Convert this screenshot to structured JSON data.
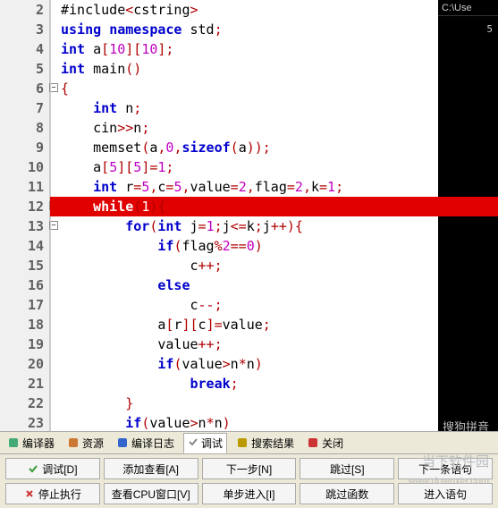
{
  "right_panel": {
    "title": "C:\\Use",
    "num": "5"
  },
  "lines": [
    {
      "n": 2,
      "fold": null,
      "hl": false,
      "indent": 0,
      "tokens": [
        [
          "id",
          "#include"
        ],
        [
          "op",
          "<"
        ],
        [
          "id",
          "cstring"
        ],
        [
          "op",
          ">"
        ]
      ]
    },
    {
      "n": 3,
      "fold": null,
      "hl": false,
      "indent": 0,
      "tokens": [
        [
          "kw",
          "using"
        ],
        [
          "id",
          " "
        ],
        [
          "kw",
          "namespace"
        ],
        [
          "id",
          " std"
        ],
        [
          "op",
          ";"
        ]
      ]
    },
    {
      "n": 4,
      "fold": null,
      "hl": false,
      "indent": 0,
      "tokens": [
        [
          "kw",
          "int"
        ],
        [
          "id",
          " a"
        ],
        [
          "op",
          "["
        ],
        [
          "num",
          "10"
        ],
        [
          "op",
          "]["
        ],
        [
          "num",
          "10"
        ],
        [
          "op",
          "];"
        ]
      ]
    },
    {
      "n": 5,
      "fold": null,
      "hl": false,
      "indent": 0,
      "tokens": [
        [
          "kw",
          "int"
        ],
        [
          "id",
          " main"
        ],
        [
          "br",
          "()"
        ]
      ]
    },
    {
      "n": 6,
      "fold": "-",
      "hl": false,
      "indent": 0,
      "tokens": [
        [
          "br",
          "{"
        ]
      ]
    },
    {
      "n": 7,
      "fold": null,
      "hl": false,
      "indent": 1,
      "tokens": [
        [
          "kw",
          "int"
        ],
        [
          "id",
          " n"
        ],
        [
          "op",
          ";"
        ]
      ]
    },
    {
      "n": 8,
      "fold": null,
      "hl": false,
      "indent": 1,
      "tokens": [
        [
          "id",
          "cin"
        ],
        [
          "op",
          ">>"
        ],
        [
          "id",
          "n"
        ],
        [
          "op",
          ";"
        ]
      ]
    },
    {
      "n": 9,
      "fold": null,
      "hl": false,
      "indent": 1,
      "tokens": [
        [
          "id",
          "memset"
        ],
        [
          "br",
          "("
        ],
        [
          "id",
          "a"
        ],
        [
          "op",
          ","
        ],
        [
          "num",
          "0"
        ],
        [
          "op",
          ","
        ],
        [
          "kw",
          "sizeof"
        ],
        [
          "br",
          "("
        ],
        [
          "id",
          "a"
        ],
        [
          "br",
          "))"
        ],
        [
          "op",
          ";"
        ]
      ]
    },
    {
      "n": 10,
      "fold": null,
      "hl": false,
      "indent": 1,
      "tokens": [
        [
          "id",
          "a"
        ],
        [
          "op",
          "["
        ],
        [
          "num",
          "5"
        ],
        [
          "op",
          "]["
        ],
        [
          "num",
          "5"
        ],
        [
          "op",
          "]="
        ],
        [
          "num",
          "1"
        ],
        [
          "op",
          ";"
        ]
      ]
    },
    {
      "n": 11,
      "fold": null,
      "hl": false,
      "indent": 1,
      "tokens": [
        [
          "kw",
          "int"
        ],
        [
          "id",
          " r"
        ],
        [
          "op",
          "="
        ],
        [
          "num",
          "5"
        ],
        [
          "op",
          ","
        ],
        [
          "id",
          "c"
        ],
        [
          "op",
          "="
        ],
        [
          "num",
          "5"
        ],
        [
          "op",
          ","
        ],
        [
          "id",
          "value"
        ],
        [
          "op",
          "="
        ],
        [
          "num",
          "2"
        ],
        [
          "op",
          ","
        ],
        [
          "id",
          "flag"
        ],
        [
          "op",
          "="
        ],
        [
          "num",
          "2"
        ],
        [
          "op",
          ","
        ],
        [
          "id",
          "k"
        ],
        [
          "op",
          "="
        ],
        [
          "num",
          "1"
        ],
        [
          "op",
          ";"
        ]
      ]
    },
    {
      "n": 12,
      "fold": "-",
      "hl": true,
      "indent": 1,
      "tokens": [
        [
          "kw",
          "while"
        ],
        [
          "br",
          "("
        ],
        [
          "num",
          "1"
        ],
        [
          "br",
          ")"
        ],
        [
          "br",
          "{"
        ]
      ]
    },
    {
      "n": 13,
      "fold": "-",
      "hl": false,
      "indent": 2,
      "tokens": [
        [
          "kw",
          "for"
        ],
        [
          "br",
          "("
        ],
        [
          "kw",
          "int"
        ],
        [
          "id",
          " j"
        ],
        [
          "op",
          "="
        ],
        [
          "num",
          "1"
        ],
        [
          "op",
          ";"
        ],
        [
          "id",
          "j"
        ],
        [
          "op",
          "<="
        ],
        [
          "id",
          "k"
        ],
        [
          "op",
          ";"
        ],
        [
          "id",
          "j"
        ],
        [
          "op",
          "++"
        ],
        [
          "br",
          ")"
        ],
        [
          "br",
          "{"
        ]
      ]
    },
    {
      "n": 14,
      "fold": null,
      "hl": false,
      "indent": 3,
      "tokens": [
        [
          "kw",
          "if"
        ],
        [
          "br",
          "("
        ],
        [
          "id",
          "flag"
        ],
        [
          "op",
          "%"
        ],
        [
          "num",
          "2"
        ],
        [
          "op",
          "=="
        ],
        [
          "num",
          "0"
        ],
        [
          "br",
          ")"
        ]
      ]
    },
    {
      "n": 15,
      "fold": null,
      "hl": false,
      "indent": 4,
      "tokens": [
        [
          "id",
          "c"
        ],
        [
          "op",
          "++;"
        ]
      ]
    },
    {
      "n": 16,
      "fold": null,
      "hl": false,
      "indent": 3,
      "tokens": [
        [
          "kw",
          "else"
        ]
      ]
    },
    {
      "n": 17,
      "fold": null,
      "hl": false,
      "indent": 4,
      "tokens": [
        [
          "id",
          "c"
        ],
        [
          "op",
          "--;"
        ]
      ]
    },
    {
      "n": 18,
      "fold": null,
      "hl": false,
      "indent": 3,
      "tokens": [
        [
          "id",
          "a"
        ],
        [
          "op",
          "["
        ],
        [
          "id",
          "r"
        ],
        [
          "op",
          "]["
        ],
        [
          "id",
          "c"
        ],
        [
          "op",
          "]="
        ],
        [
          "id",
          "value"
        ],
        [
          "op",
          ";"
        ]
      ]
    },
    {
      "n": 19,
      "fold": null,
      "hl": false,
      "indent": 3,
      "tokens": [
        [
          "id",
          "value"
        ],
        [
          "op",
          "++;"
        ]
      ]
    },
    {
      "n": 20,
      "fold": null,
      "hl": false,
      "indent": 3,
      "tokens": [
        [
          "kw",
          "if"
        ],
        [
          "br",
          "("
        ],
        [
          "id",
          "value"
        ],
        [
          "op",
          ">"
        ],
        [
          "id",
          "n"
        ],
        [
          "op",
          "*"
        ],
        [
          "id",
          "n"
        ],
        [
          "br",
          ")"
        ]
      ]
    },
    {
      "n": 21,
      "fold": null,
      "hl": false,
      "indent": 4,
      "tokens": [
        [
          "kw",
          "break"
        ],
        [
          "op",
          ";"
        ]
      ]
    },
    {
      "n": 22,
      "fold": null,
      "hl": false,
      "indent": 2,
      "tokens": [
        [
          "br",
          "}"
        ]
      ]
    },
    {
      "n": 23,
      "fold": null,
      "hl": false,
      "indent": 2,
      "tokens": [
        [
          "kw",
          "if"
        ],
        [
          "br",
          "("
        ],
        [
          "id",
          "value"
        ],
        [
          "op",
          ">"
        ],
        [
          "id",
          "n"
        ],
        [
          "op",
          "*"
        ],
        [
          "id",
          "n"
        ],
        [
          "br",
          ")"
        ]
      ]
    }
  ],
  "tabs": [
    {
      "label": "编译器",
      "icon": "#4a7",
      "active": false
    },
    {
      "label": "资源",
      "icon": "#c73",
      "active": false
    },
    {
      "label": "编译日志",
      "icon": "#36c",
      "active": false
    },
    {
      "label": "调试",
      "icon": "#888",
      "active": true
    },
    {
      "label": "搜索结果",
      "icon": "#b90",
      "active": false
    },
    {
      "label": "关闭",
      "icon": "#c33",
      "active": false
    }
  ],
  "buttons": {
    "row1": [
      {
        "label": "调试[D]",
        "icon": "check",
        "color": "#393"
      },
      {
        "label": "添加查看[A]",
        "icon": "",
        "color": ""
      },
      {
        "label": "下一步[N]",
        "icon": "",
        "color": ""
      },
      {
        "label": "跳过[S]",
        "icon": "",
        "color": ""
      },
      {
        "label": "下一条语句",
        "icon": "",
        "color": ""
      }
    ],
    "row2": [
      {
        "label": "停止执行",
        "icon": "cross",
        "color": "#c33"
      },
      {
        "label": "查看CPU窗口[V]",
        "icon": "",
        "color": ""
      },
      {
        "label": "单步进入[I]",
        "icon": "",
        "color": ""
      },
      {
        "label": "跳过函数",
        "icon": "",
        "color": ""
      },
      {
        "label": "进入语句",
        "icon": "",
        "color": ""
      }
    ]
  },
  "watermarks": {
    "w1": "搜狗拼音",
    "w2": "当下软件园",
    "w3": "www.downxia.com"
  }
}
